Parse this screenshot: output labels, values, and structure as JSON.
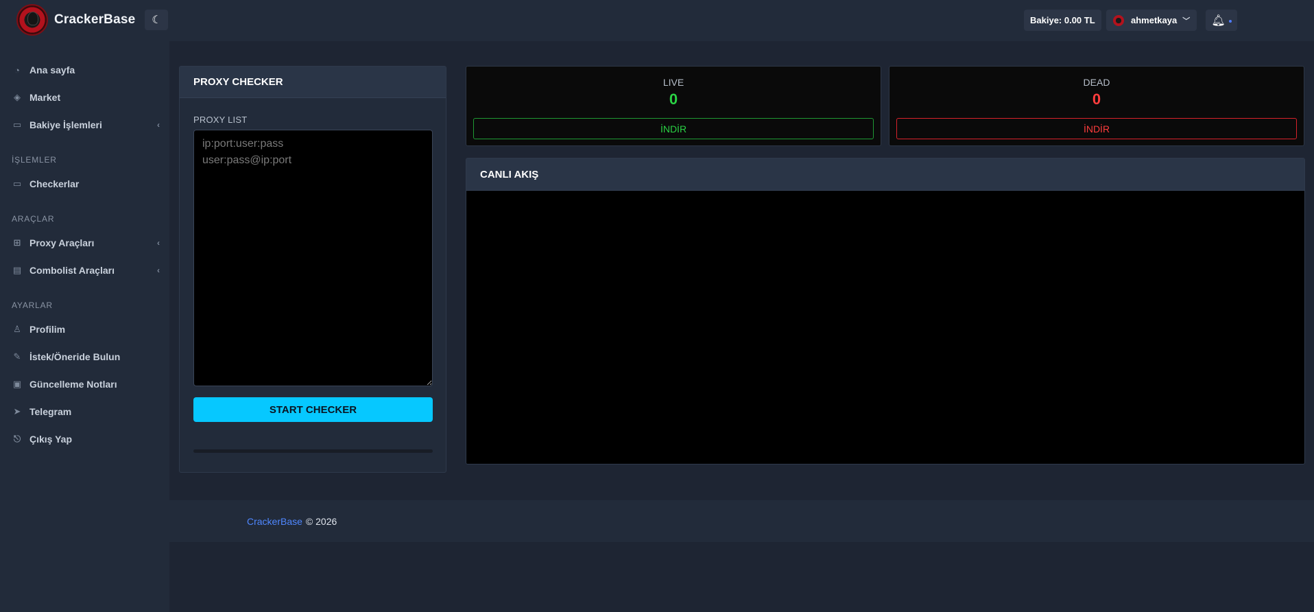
{
  "brand": {
    "name": "CrackerBase",
    "logo_icon": "skull-logo",
    "theme_icon": "moon-icon"
  },
  "sidebar": {
    "groups": [
      {
        "items": [
          {
            "label": "Ana sayfa",
            "icon": "gauge-icon"
          },
          {
            "label": "Market",
            "icon": "layers-icon"
          },
          {
            "label": "Bakiye İşlemleri",
            "icon": "card-icon",
            "expandable": true
          }
        ]
      },
      {
        "header": "İŞLEMLER",
        "items": [
          {
            "label": "Checkerlar",
            "icon": "card-icon"
          }
        ]
      },
      {
        "header": "ARAÇLAR",
        "items": [
          {
            "label": "Proxy Araçları",
            "icon": "network-icon",
            "expandable": true
          },
          {
            "label": "Combolist Araçları",
            "icon": "file-edit-icon",
            "expandable": true
          }
        ]
      },
      {
        "header": "AYARLAR",
        "items": [
          {
            "label": "Profilim",
            "icon": "user-icon"
          },
          {
            "label": "İstek/Öneride Bulun",
            "icon": "pencil-icon"
          },
          {
            "label": "Güncelleme Notları",
            "icon": "clipboard-icon"
          },
          {
            "label": "Telegram",
            "icon": "telegram-icon"
          },
          {
            "label": "Çıkış Yap",
            "icon": "door-icon"
          }
        ]
      }
    ]
  },
  "topbar": {
    "balance": "Bakiye: 0.00 TL",
    "username": "ahmetkaya",
    "bell_icon": "bell-icon",
    "notification_dot_color": "#4f7cff"
  },
  "proxy_checker": {
    "title": "PROXY CHECKER",
    "list_label": "PROXY LIST",
    "placeholder": "ip:port:user:pass\nuser:pass@ip:port",
    "start_label": "START CHECKER",
    "progress": 0
  },
  "stats": {
    "live": {
      "title": "LIVE",
      "count": "0",
      "download_label": "İNDİR",
      "color": "#2ad244"
    },
    "dead": {
      "title": "DEAD",
      "count": "0",
      "download_label": "İNDİR",
      "color": "#ff3d3d"
    }
  },
  "feed": {
    "title": "CANLI AKIŞ"
  },
  "footer": {
    "brand_link": "CrackerBase",
    "copyright": "© 2026"
  },
  "colors": {
    "accent": "#06c8ff",
    "background": "#1e2533",
    "panel": "#222b3a"
  }
}
